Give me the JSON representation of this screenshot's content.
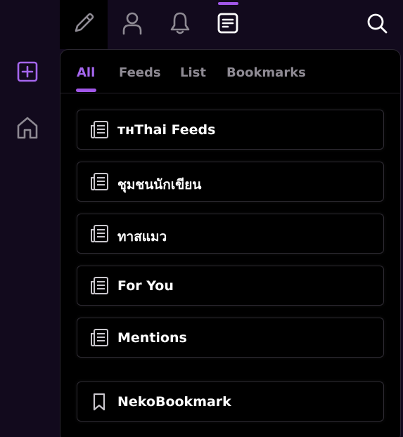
{
  "top_nav": {
    "compose_icon": "pencil-icon",
    "profile_icon": "user-icon",
    "notifications_icon": "bell-icon",
    "feeds_icon": "document-list-icon",
    "search_icon": "search-icon",
    "active_color": "#a157e8"
  },
  "side_rail": {
    "add_icon": "plus-square-icon",
    "home_icon": "home-icon"
  },
  "tabs": [
    {
      "label": "All",
      "active": true
    },
    {
      "label": "Feeds",
      "active": false
    },
    {
      "label": "List",
      "active": false
    },
    {
      "label": "Bookmarks",
      "active": false
    }
  ],
  "feed_items": [
    {
      "label": "ᴛʜThai Feeds",
      "icon": "newspaper-icon"
    },
    {
      "label": "ชุมชนนักเขียน",
      "icon": "newspaper-icon"
    },
    {
      "label": "ทาสแมว",
      "icon": "newspaper-icon"
    },
    {
      "label": "For You",
      "icon": "newspaper-icon"
    },
    {
      "label": "Mentions",
      "icon": "newspaper-icon"
    }
  ],
  "bookmark_items": [
    {
      "label": "NekoBookmark",
      "icon": "bookmark-icon"
    }
  ],
  "colors": {
    "background": "#120a1d",
    "panel": "#000000",
    "accent": "#a566ee",
    "muted_text": "#8e8a93"
  }
}
